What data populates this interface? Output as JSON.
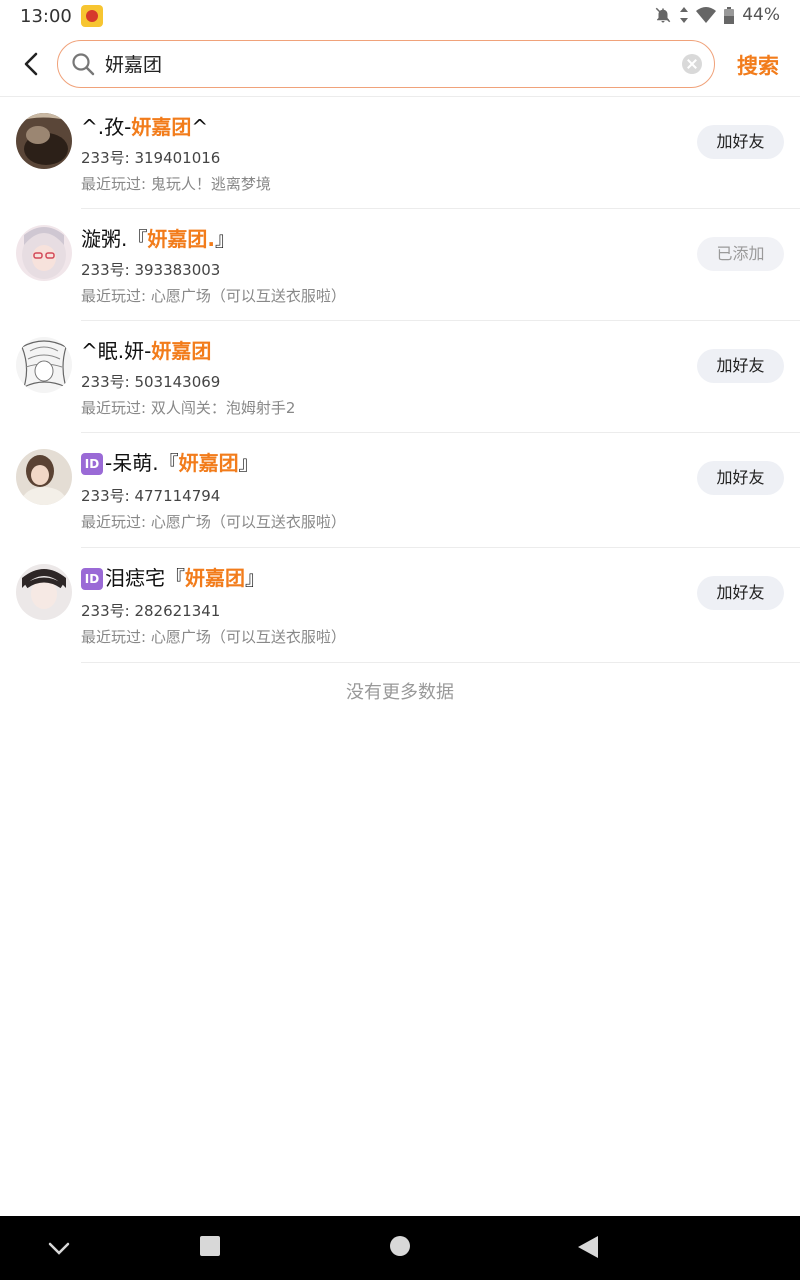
{
  "status_bar": {
    "time": "13:00",
    "battery": "44%"
  },
  "search": {
    "query": "妍嘉团",
    "button_label": "搜索"
  },
  "results": [
    {
      "name_prefix": "^.孜-",
      "name_highlight": "妍嘉团",
      "name_suffix": "^",
      "has_id_badge": false,
      "uid": "233号: 319401016",
      "recent": "最近玩过: 鬼玩人！逃离梦境",
      "action": "加好友",
      "added": false
    },
    {
      "name_prefix": "漩粥.『",
      "name_highlight": "妍嘉团.",
      "name_suffix": "』",
      "has_id_badge": false,
      "uid": "233号: 393383003",
      "recent": "最近玩过: 心愿广场（可以互送衣服啦）",
      "action": "已添加",
      "added": true
    },
    {
      "name_prefix": "^眠.妍-",
      "name_highlight": "妍嘉团",
      "name_suffix": "",
      "has_id_badge": false,
      "uid": "233号: 503143069",
      "recent": "最近玩过: 双人闯关：泡姆射手2",
      "action": "加好友",
      "added": false
    },
    {
      "name_prefix": "-呆萌.『",
      "name_highlight": "妍嘉团",
      "name_suffix": "』",
      "has_id_badge": true,
      "uid": "233号: 477114794",
      "recent": "最近玩过: 心愿广场（可以互送衣服啦）",
      "action": "加好友",
      "added": false
    },
    {
      "name_prefix": "泪痣宅『",
      "name_highlight": "妍嘉团",
      "name_suffix": "』",
      "has_id_badge": true,
      "uid": "233号: 282621341",
      "recent": "最近玩过: 心愿广场（可以互送衣服啦）",
      "action": "加好友",
      "added": false
    }
  ],
  "id_badge_text": "ID",
  "footer": {
    "no_more": "没有更多数据"
  },
  "colors": {
    "accent": "#f27c1b",
    "search_border": "#f0a27a",
    "badge": "#9a6ad6"
  },
  "icons": {
    "back": "chevron-left-icon",
    "search": "search-icon",
    "clear": "clear-icon",
    "nav_back": "triangle-back-icon",
    "nav_home": "circle-home-icon",
    "nav_recent": "square-recents-icon"
  }
}
